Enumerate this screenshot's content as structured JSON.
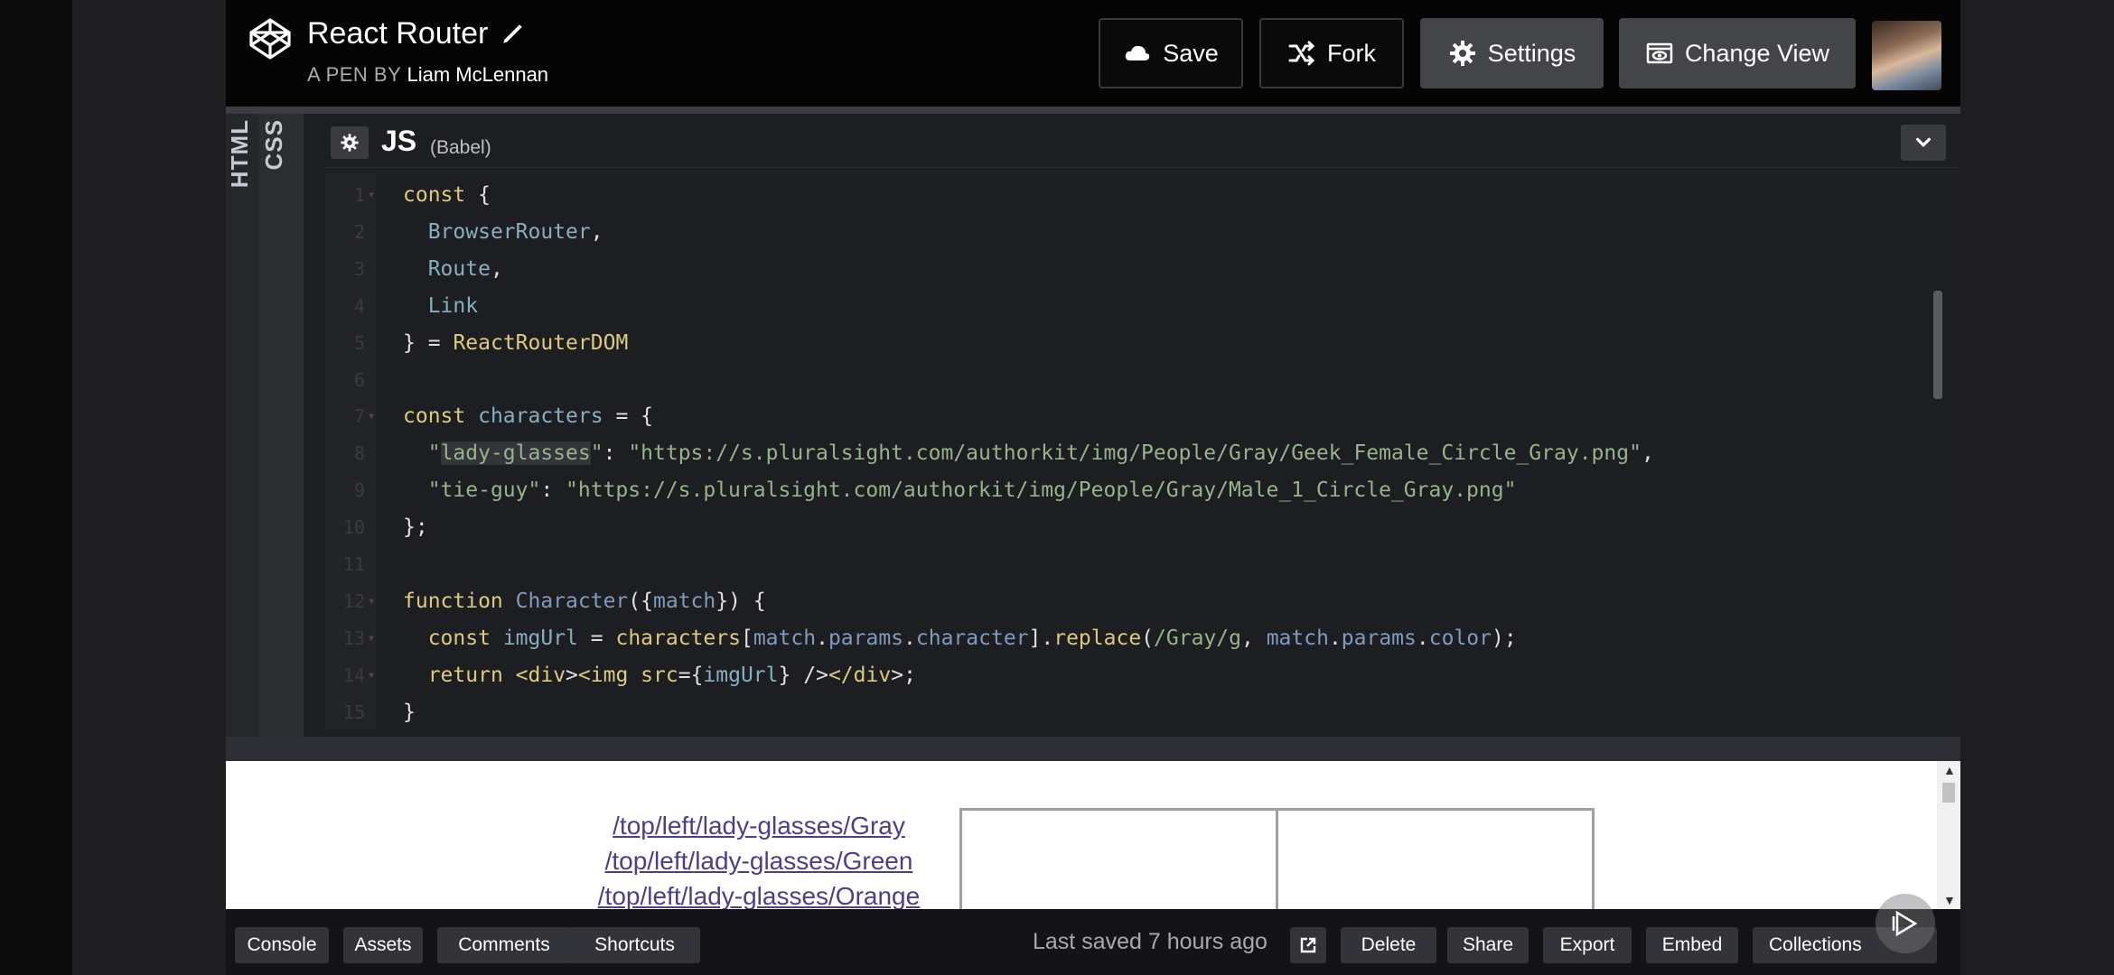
{
  "header": {
    "title": "React Router",
    "byline_prefix": "A PEN BY",
    "author": "Liam McLennan",
    "buttons": {
      "save": "Save",
      "fork": "Fork",
      "settings": "Settings",
      "change_view": "Change View"
    }
  },
  "editor": {
    "side_tabs": {
      "html": "HTML",
      "css": "CSS"
    },
    "js_label": "JS",
    "js_preprocessor": "(Babel)"
  },
  "code_lines": [
    {
      "n": "1",
      "text": "const {"
    },
    {
      "n": "2",
      "text": "  BrowserRouter,"
    },
    {
      "n": "3",
      "text": "  Route,"
    },
    {
      "n": "4",
      "text": "  Link"
    },
    {
      "n": "5",
      "text": "} = ReactRouterDOM"
    },
    {
      "n": "6",
      "text": ""
    },
    {
      "n": "7",
      "text": "const characters = {"
    },
    {
      "n": "8",
      "text": "  \"lady-glasses\": \"https://s.pluralsight.com/authorkit/img/People/Gray/Geek_Female_Circle_Gray.png\","
    },
    {
      "n": "9",
      "text": "  \"tie-guy\": \"https://s.pluralsight.com/authorkit/img/People/Gray/Male_1_Circle_Gray.png\""
    },
    {
      "n": "10",
      "text": "};"
    },
    {
      "n": "11",
      "text": ""
    },
    {
      "n": "12",
      "text": "function Character({match}) {"
    },
    {
      "n": "13",
      "text": "  const imgUrl = characters[match.params.character].replace(/Gray/g, match.params.color);"
    },
    {
      "n": "14",
      "text": "  return <div><img src={imgUrl} /></div>;"
    },
    {
      "n": "15",
      "text": "}"
    }
  ],
  "preview": {
    "links": [
      "/top/left/lady-glasses/Gray",
      "/top/left/lady-glasses/Green",
      "/top/left/lady-glasses/Orange"
    ]
  },
  "footer": {
    "console": "Console",
    "assets": "Assets",
    "comments": "Comments",
    "shortcuts": "Shortcuts",
    "last_saved": "Last saved 7 hours ago",
    "delete": "Delete",
    "share": "Share",
    "export": "Export",
    "embed": "Embed",
    "collections": "Collections"
  }
}
